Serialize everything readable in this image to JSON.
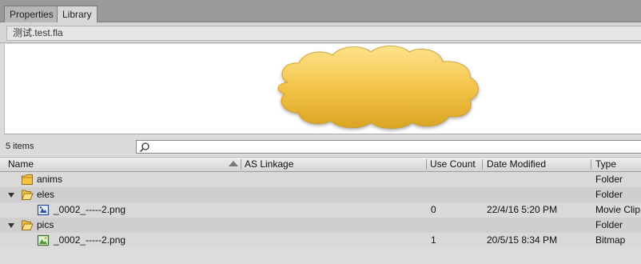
{
  "tabs": [
    {
      "label": "Properties"
    },
    {
      "label": "Library"
    }
  ],
  "document": {
    "name": "测试.test.fla"
  },
  "library": {
    "count_label": "5 items"
  },
  "search": {
    "placeholder": ""
  },
  "columns": {
    "name": "Name",
    "linkage": "AS Linkage",
    "use_count": "Use Count",
    "date_modified": "Date Modified",
    "type": "Type"
  },
  "items": [
    {
      "name": "anims",
      "icon": "folder-closed-icon",
      "use_count": "",
      "date": "",
      "type": "Folder"
    },
    {
      "name": "eles",
      "icon": "folder-open-icon",
      "use_count": "",
      "date": "",
      "type": "Folder"
    },
    {
      "name": "_0002_-----2.png",
      "icon": "movie-clip-icon",
      "use_count": "0",
      "date": "22/4/16 5:20 PM",
      "type": "Movie Clip"
    },
    {
      "name": "pics",
      "icon": "folder-open-icon",
      "use_count": "",
      "date": "",
      "type": "Folder"
    },
    {
      "name": "_0002_-----2.png",
      "icon": "bitmap-icon",
      "use_count": "1",
      "date": "20/5/15 8:34 PM",
      "type": "Bitmap"
    }
  ],
  "colors": {
    "cloud_fill": "#f2c144",
    "folder_fill": "#f5c542"
  }
}
